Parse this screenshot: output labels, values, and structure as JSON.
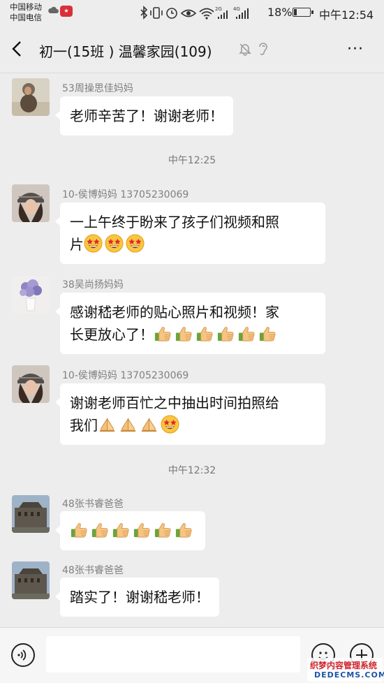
{
  "status_bar": {
    "carrier1": "中国移动",
    "carrier2": "中国电信",
    "battery": "18%",
    "battery_level": 0.18,
    "time": "中午12:54"
  },
  "header": {
    "title": "初一(15班 ) 温馨家园(109)",
    "more": "···"
  },
  "messages": [
    {
      "sender": "53周操思佳妈妈",
      "lines": [
        "老师辛苦了！谢谢老师！"
      ],
      "avatar": "baby-photo"
    },
    {
      "time": "中午12:25"
    },
    {
      "sender": "10-侯博妈妈 13705230069",
      "lines": [
        "一上午终于盼来了孩子们视频和照",
        "片"
      ],
      "emoji": [
        "star-struck",
        "star-struck",
        "star-struck"
      ],
      "avatar": "woman-hat-photo"
    },
    {
      "sender": "38吴尚扬妈妈",
      "lines": [
        "感谢嵇老师的贴心照片和视频！家",
        "长更放心了！"
      ],
      "emoji": [
        "thumbs-up",
        "thumbs-up",
        "thumbs-up",
        "thumbs-up",
        "thumbs-up",
        "thumbs-up"
      ],
      "avatar": "flowers-photo"
    },
    {
      "sender": "10-侯博妈妈 13705230069",
      "lines": [
        "谢谢老师百忙之中抽出时间拍照给",
        "我们"
      ],
      "emoji": [
        "folded-hands",
        "folded-hands",
        "folded-hands",
        "star-struck"
      ],
      "avatar": "woman-hat-photo"
    },
    {
      "time": "中午12:32"
    },
    {
      "sender": "48张书睿爸爸",
      "emoji": [
        "thumbs-up",
        "thumbs-up",
        "thumbs-up",
        "thumbs-up",
        "thumbs-up",
        "thumbs-up"
      ],
      "avatar": "building-photo"
    },
    {
      "sender": "48张书睿爸爸",
      "lines": [
        "踏实了！谢谢嵇老师！"
      ],
      "avatar": "building-photo"
    }
  ],
  "watermark": {
    "line1": "织梦内容管理系统",
    "line2": "DEDECMS.COM"
  },
  "colors": {
    "background": "#ededed",
    "bubble": "#ffffff",
    "sender": "#808080"
  }
}
